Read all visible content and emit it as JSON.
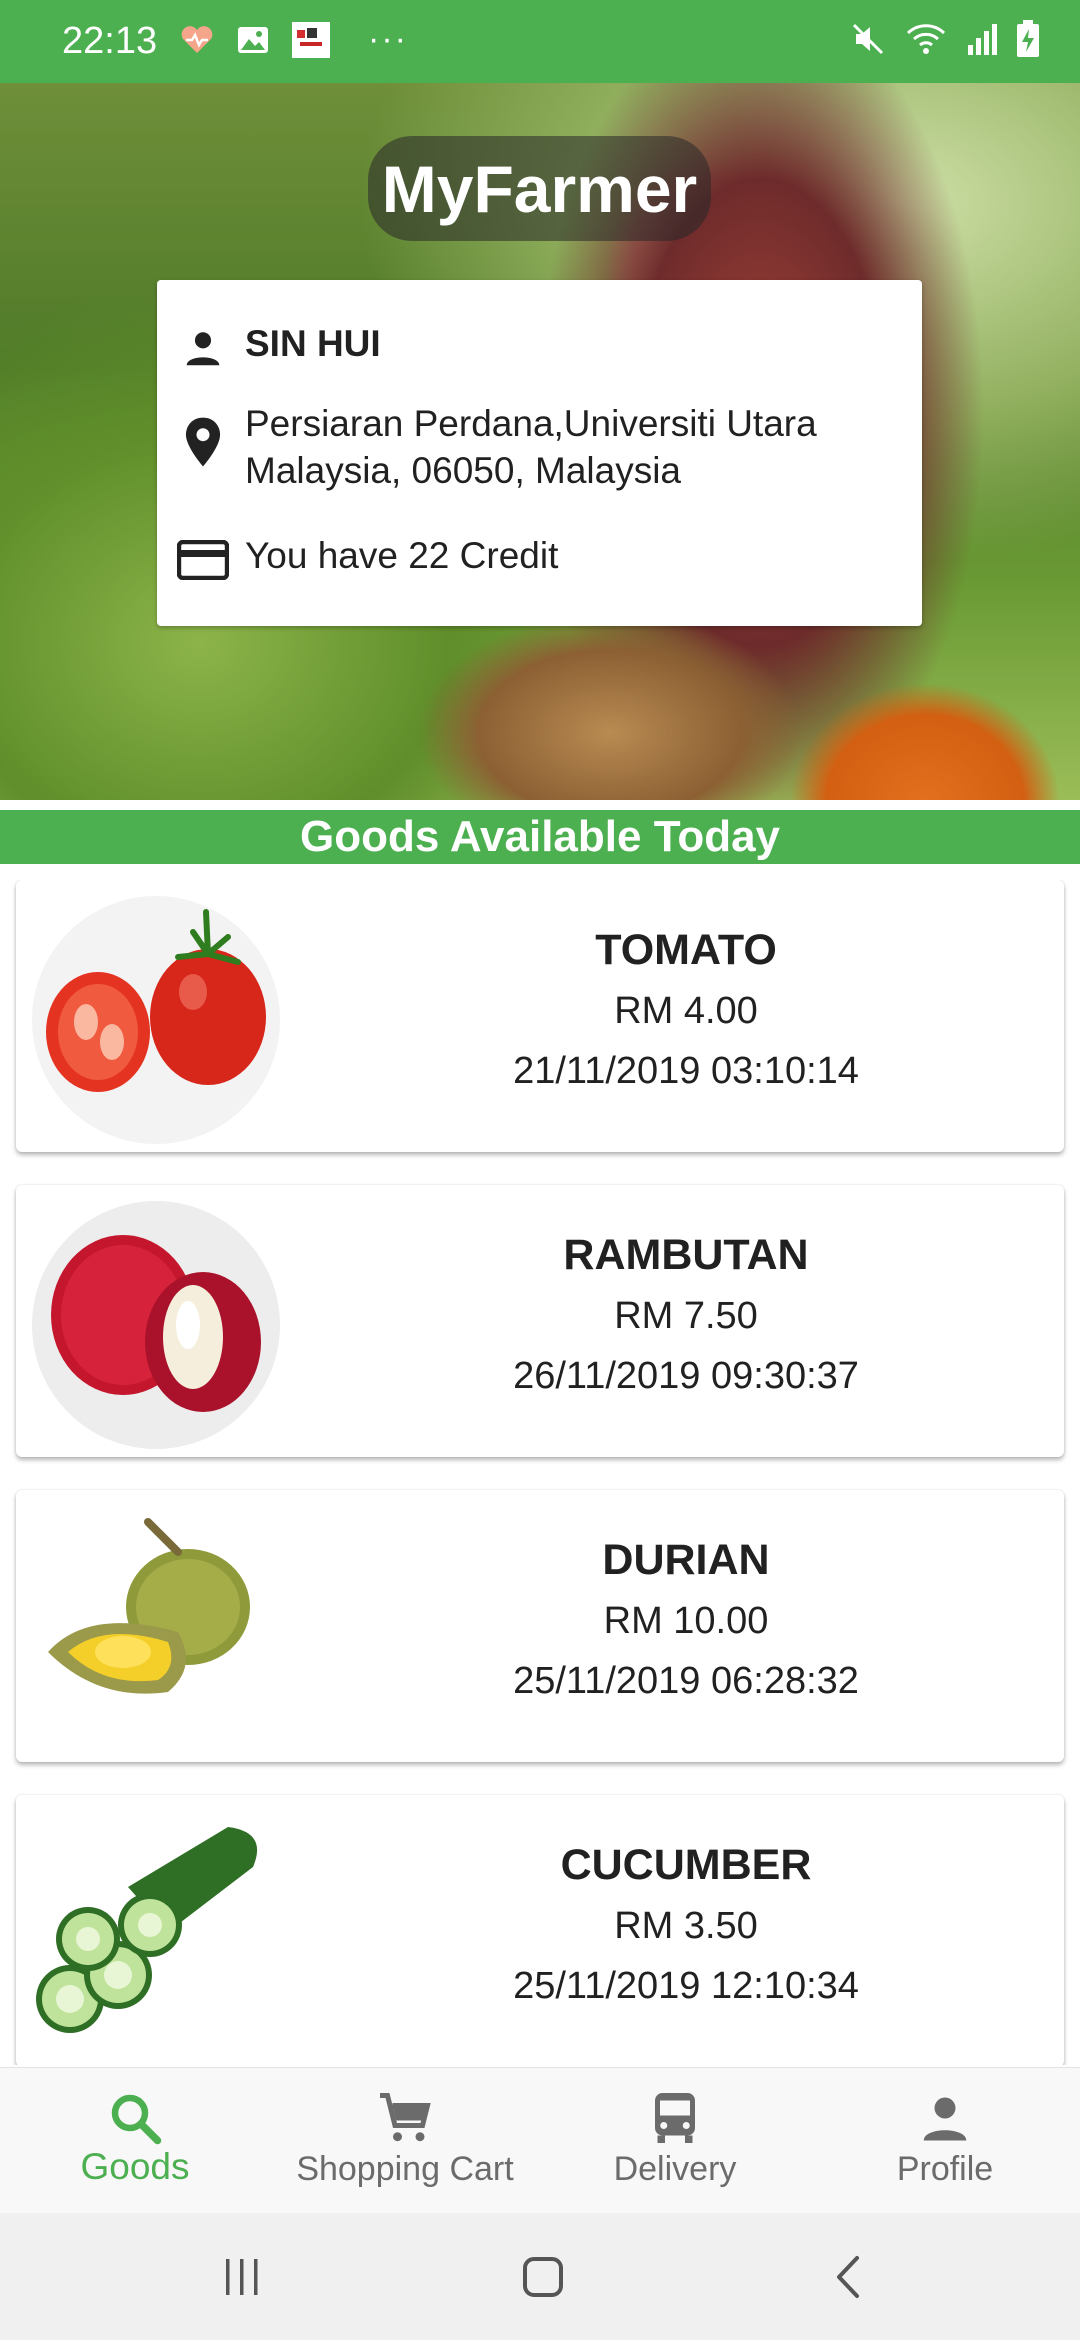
{
  "status_bar": {
    "time": "22:13",
    "icons_left": [
      "heart-rate-icon",
      "gallery-icon",
      "app-notification-icon"
    ],
    "more": "···",
    "icons_right": [
      "mute-icon",
      "wifi-icon",
      "signal-icon",
      "battery-charging-icon"
    ]
  },
  "header": {
    "app_title": "MyFarmer"
  },
  "profile": {
    "name": "SIN HUI",
    "address_line1": "Persiaran Perdana,Universiti Utara",
    "address_line2": "Malaysia, 06050, Malaysia",
    "credit": "You have 22 Credit"
  },
  "section": {
    "title": "Goods Available Today"
  },
  "goods": [
    {
      "name": "TOMATO",
      "price": "RM 4.00",
      "date": "21/11/2019 03:10:14",
      "icon": "tomato-image"
    },
    {
      "name": "RAMBUTAN",
      "price": "RM 7.50",
      "date": "26/11/2019 09:30:37",
      "icon": "rambutan-image"
    },
    {
      "name": "DURIAN",
      "price": "RM 10.00",
      "date": "25/11/2019 06:28:32",
      "icon": "durian-image"
    },
    {
      "name": "CUCUMBER",
      "price": "RM 3.50",
      "date": "25/11/2019 12:10:34",
      "icon": "cucumber-image"
    }
  ],
  "bottom_nav": {
    "items": [
      {
        "label": "Goods",
        "icon": "search-icon",
        "active": true
      },
      {
        "label": "Shopping Cart",
        "icon": "cart-icon",
        "active": false
      },
      {
        "label": "Delivery",
        "icon": "bus-icon",
        "active": false
      },
      {
        "label": "Profile",
        "icon": "person-icon",
        "active": false
      }
    ]
  },
  "colors": {
    "primary": "#4caf50",
    "nav_inactive": "#6b6b6b"
  }
}
